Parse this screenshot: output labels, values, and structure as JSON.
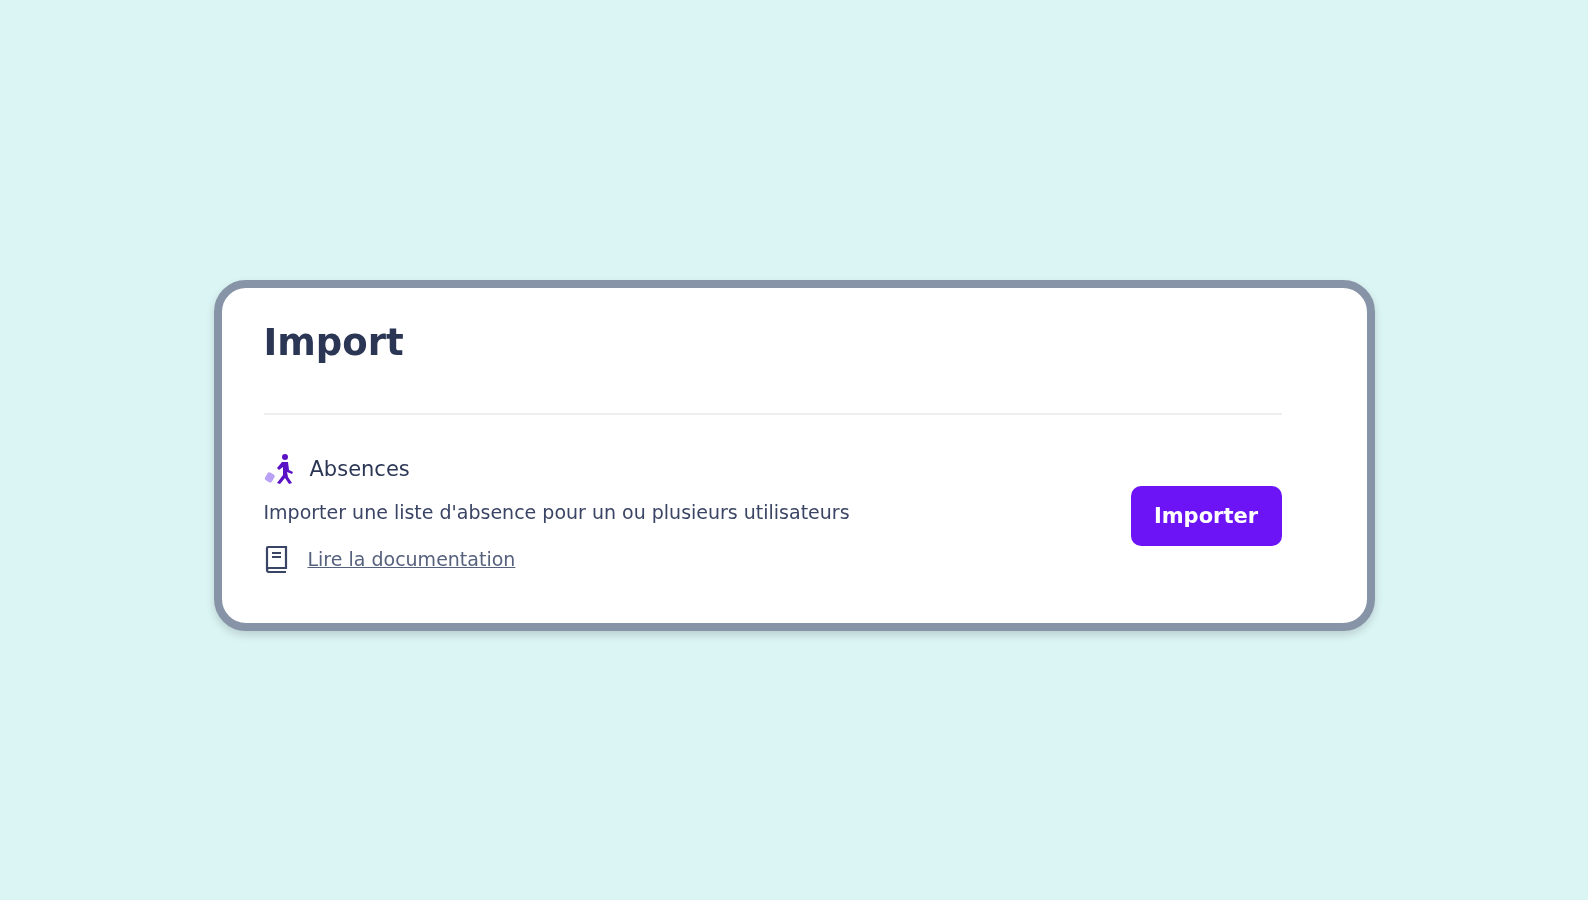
{
  "title": "Import",
  "sections": [
    {
      "name": "Absences",
      "description": "Importer une liste d'absence pour un ou plusieurs utilisateurs",
      "link": "Lire la documentation",
      "button": "Importer"
    }
  ]
}
